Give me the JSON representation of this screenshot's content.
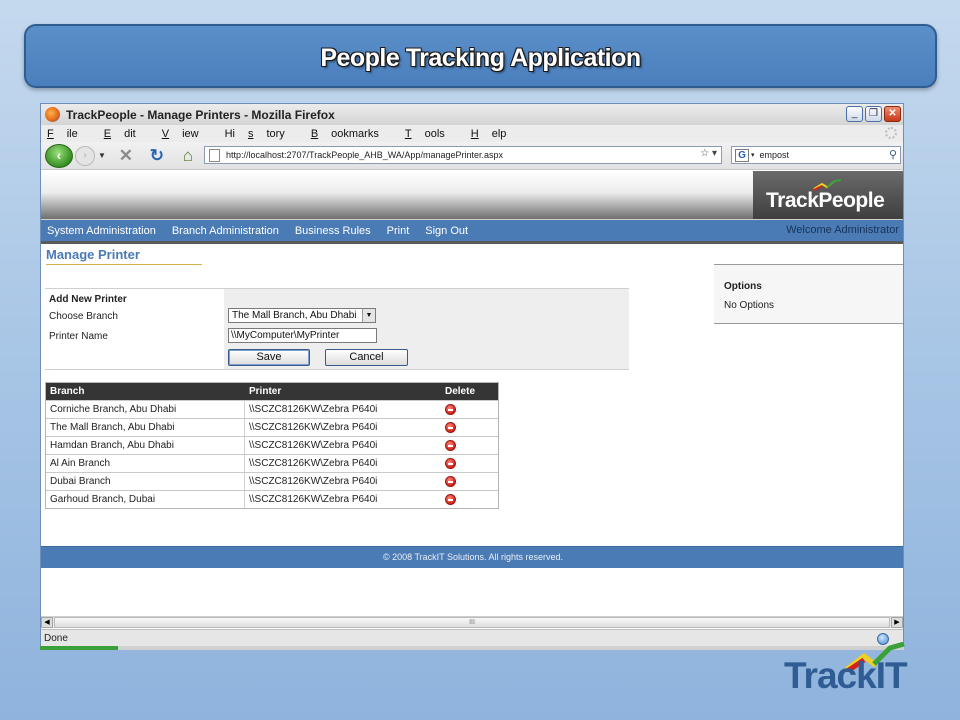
{
  "slide": {
    "title": "People Tracking Application"
  },
  "browser": {
    "title": "TrackPeople - Manage Printers - Mozilla Firefox",
    "window_buttons": {
      "minimize": "_",
      "maximize": "❐",
      "close": "✕"
    },
    "menu": [
      "File",
      "Edit",
      "View",
      "History",
      "Bookmarks",
      "Tools",
      "Help"
    ],
    "menu_underline": [
      "F",
      "E",
      "V",
      "s",
      "B",
      "T",
      "H"
    ],
    "url": "http://localhost:2707/TrackPeople_AHB_WA/App/managePrinter.aspx",
    "url_star": "☆ ▾",
    "search_engine": "G",
    "search_value": "empost",
    "status": "Done",
    "scroll_grip": "III"
  },
  "site": {
    "logo_prefix": "Track",
    "logo_suffix": "People",
    "nav": [
      "System Administration",
      "Branch Administration",
      "Business Rules",
      "Print",
      "Sign Out"
    ],
    "welcome": "Welcome Administrator",
    "page_title": "Manage Printer",
    "options": {
      "title": "Options",
      "text": "No Options"
    },
    "form": {
      "heading": "Add New Printer",
      "branch_label": "Choose Branch",
      "printer_label": "Printer Name",
      "branch_value": "The Mall Branch, Abu Dhabi",
      "printer_value": "\\\\MyComputer\\MyPrinter",
      "save_label": "Save",
      "cancel_label": "Cancel"
    },
    "table": {
      "headers": [
        "Branch",
        "Printer",
        "Delete"
      ],
      "rows": [
        {
          "branch": "Corniche Branch, Abu Dhabi",
          "printer": "\\\\SCZC8126KW\\Zebra P640i"
        },
        {
          "branch": "The Mall Branch, Abu Dhabi",
          "printer": "\\\\SCZC8126KW\\Zebra P640i"
        },
        {
          "branch": "Hamdan Branch, Abu Dhabi",
          "printer": "\\\\SCZC8126KW\\Zebra P640i"
        },
        {
          "branch": "Al Ain Branch",
          "printer": "\\\\SCZC8126KW\\Zebra P640i"
        },
        {
          "branch": "Dubai Branch",
          "printer": "\\\\SCZC8126KW\\Zebra P640i"
        },
        {
          "branch": "Garhoud Branch, Dubai",
          "printer": "\\\\SCZC8126KW\\Zebra P640i"
        }
      ]
    },
    "footer": "© 2008 TrackIT Solutions. All rights reserved."
  },
  "brand": {
    "trackit": "TrackIT",
    "colors": {
      "primary": "#2e5c93",
      "nav": "#4a7bb5",
      "mark_green": "#3aa03a",
      "mark_yellow": "#f0d020",
      "mark_red": "#d4201a"
    }
  },
  "icons": [
    "firefox-icon",
    "back-arrow-icon",
    "forward-arrow-icon",
    "stop-icon",
    "reload-icon",
    "home-icon",
    "page-icon",
    "search-icon",
    "delete-icon",
    "status-icon"
  ]
}
